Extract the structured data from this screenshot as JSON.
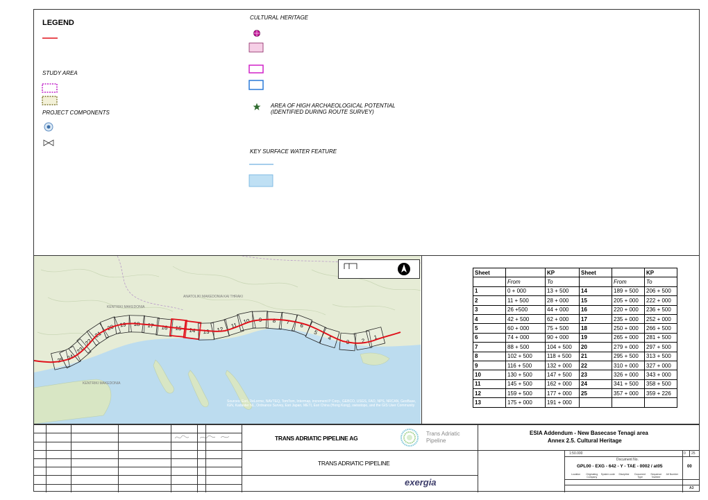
{
  "legend": {
    "title": "LEGEND",
    "study_area": "STUDY AREA",
    "project_components": "PROJECT COMPONENTS",
    "cultural_heritage": "CULTURAL HERITAGE",
    "archaeo_line1": "AREA OF HIGH ARCHAEOLOGICAL POTENTIAL",
    "archaeo_line2": "(IDENTIFIED DURING ROUTE SURVEY)",
    "water": "KEY SURFACE WATER FEATURE"
  },
  "map": {
    "sheet_labels": [
      "25",
      "24",
      "23",
      "22",
      "21",
      "20",
      "19",
      "18",
      "17",
      "16",
      "15",
      "14",
      "13",
      "12",
      "11",
      "10",
      "9",
      "8",
      "7",
      "6",
      "5",
      "4",
      "3",
      "2",
      "1"
    ],
    "place_labels": [
      "KENTRIKI MAKEDONIA",
      "ANATOLIKI MAKEDONIA KAI THRAKI",
      "KENTRIKI MAKEDONIA"
    ],
    "attribution": "Sources: Esri, DeLorme, NAVTEQ, TomTom, Intermap, increment P Corp., GEBCO, USGS, FAO, NPS, NRCAN, GeoBase, IGN, Kadaster NL, Ordnance Survey, Esri Japan, METI, Esri China (Hong Kong), swisstopo, and the GIS User Community"
  },
  "kp_table": {
    "header": [
      "Sheet",
      "",
      "KP",
      "Sheet",
      "",
      "KP"
    ],
    "subheader": [
      "",
      "From",
      "To",
      "",
      "From",
      "To"
    ],
    "rows": [
      [
        "1",
        "0 + 000",
        "13 + 500",
        "14",
        "189 + 500",
        "206 + 500"
      ],
      [
        "2",
        "11 + 500",
        "28 + 000",
        "15",
        "205 + 000",
        "222 + 000"
      ],
      [
        "3",
        "26 +500",
        "44 + 000",
        "16",
        "220 + 000",
        "236 + 500"
      ],
      [
        "4",
        "42 + 500",
        "62 + 000",
        "17",
        "235 + 000",
        "252 + 000"
      ],
      [
        "5",
        "60 + 000",
        "75 + 500",
        "18",
        "250 + 000",
        "266 + 500"
      ],
      [
        "6",
        "74 + 000",
        "90 + 000",
        "19",
        "265 + 000",
        "281 + 500"
      ],
      [
        "7",
        "88 + 500",
        "104 + 500",
        "20",
        "279 + 000",
        "297 + 500"
      ],
      [
        "8",
        "102 + 500",
        "118 + 500",
        "21",
        "295 + 500",
        "313 + 500"
      ],
      [
        "9",
        "116 + 500",
        "132 + 000",
        "22",
        "310 + 000",
        "327 + 000"
      ],
      [
        "10",
        "130 + 500",
        "147 + 500",
        "23",
        "326 + 000",
        "343 + 000"
      ],
      [
        "11",
        "145 + 500",
        "162 + 000",
        "24",
        "341 + 500",
        "358 + 500"
      ],
      [
        "12",
        "159 + 500",
        "177 + 000",
        "25",
        "357 + 000",
        "359 + 226"
      ],
      [
        "13",
        "175 + 000",
        "191 + 000",
        "",
        "",
        ""
      ]
    ]
  },
  "title_block": {
    "company": "TRANS ADRIATIC PIPELINE AG",
    "logo_text_1": "Trans Adriatic",
    "logo_text_2": "Pipeline",
    "project": "TRANS ADRIATIC PIPELINE",
    "contractor": "exergia",
    "title_1": "ESIA Addendum - New Basecase Tenagi area",
    "title_2": "Annex 2.5. Cultural Heritage",
    "scale": "1:50.000",
    "sheet_a": "0",
    "sheet_b": "25",
    "doc_no_label": "Document No.",
    "doc_no": "GPL00 - EXG - 642 - Y - TAE - 0002 / at05",
    "revision": "00",
    "sublabels": [
      "Location",
      "Originating Company",
      "System code",
      "Discipline",
      "Document Type",
      "Sequence Number",
      "Alt Number"
    ],
    "size": "A3"
  },
  "colors": {
    "pipeline": "#e0101a",
    "water_line": "#6fb1e0",
    "water_fill": "#bfe0f4",
    "archaeo_star": "#2f6b2f",
    "study_magenta": "#c020c8",
    "study_olive": "#a09a10"
  }
}
